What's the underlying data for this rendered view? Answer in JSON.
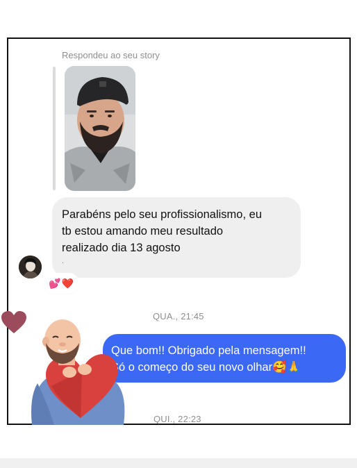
{
  "story_reply": {
    "label": "Respondeu ao seu story"
  },
  "messages": {
    "incoming": {
      "lines": [
        "Parabéns pelo seu profissionalismo, eu",
        "tb estou amando meu resultado",
        "realizado dia 13 agosto"
      ],
      "trailing": "."
    },
    "reactions": [
      "💕",
      "❤️"
    ],
    "timestamp_1": "QUA., 21:45",
    "outgoing": {
      "lines": [
        "Que bom!! Obrigado pela mensagem!!",
        "Só o começo do seu novo olhar🥰🙏"
      ]
    },
    "timestamp_2": "QUI., 22:23"
  },
  "colors": {
    "incoming_bubble": "#efefef",
    "outgoing_bubble": "#3b69f6",
    "timestamp": "#8e8e8e"
  },
  "icons": {
    "float_heart": "heart-icon",
    "sticker": "avatar-heart-sticker"
  }
}
